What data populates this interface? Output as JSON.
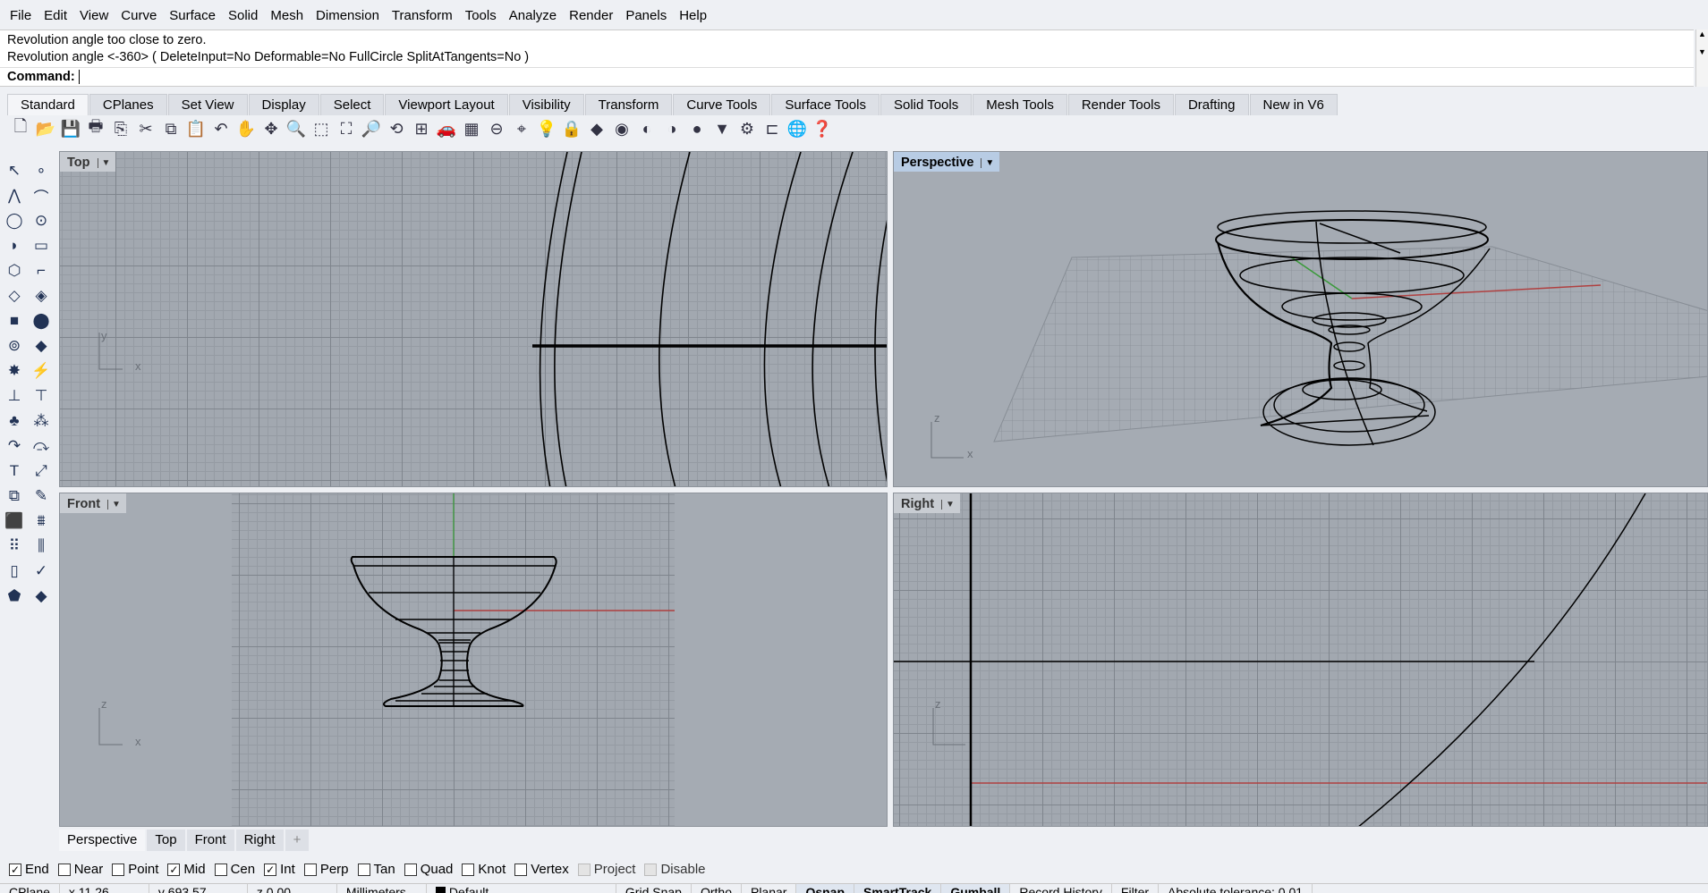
{
  "menu": [
    "File",
    "Edit",
    "View",
    "Curve",
    "Surface",
    "Solid",
    "Mesh",
    "Dimension",
    "Transform",
    "Tools",
    "Analyze",
    "Render",
    "Panels",
    "Help"
  ],
  "command": {
    "history": [
      "Revolution angle too close to zero.",
      "Revolution angle <-360> ( DeleteInput=No  Deformable=No  FullCircle  SplitAtTangents=No )"
    ],
    "prompt": "Command:",
    "value": ""
  },
  "toolbar_tabs": [
    "Standard",
    "CPlanes",
    "Set View",
    "Display",
    "Select",
    "Viewport Layout",
    "Visibility",
    "Transform",
    "Curve Tools",
    "Surface Tools",
    "Solid Tools",
    "Mesh Tools",
    "Render Tools",
    "Drafting",
    "New in V6"
  ],
  "active_toolbar_tab": "Standard",
  "standard_icons": [
    {
      "name": "new-icon",
      "g": "🗋"
    },
    {
      "name": "open-icon",
      "g": "📂"
    },
    {
      "name": "save-icon",
      "g": "💾"
    },
    {
      "name": "print-icon",
      "g": "🖶"
    },
    {
      "name": "import-icon",
      "g": "⎘"
    },
    {
      "name": "cut-icon",
      "g": "✂"
    },
    {
      "name": "copy-icon",
      "g": "⧉"
    },
    {
      "name": "paste-icon",
      "g": "📋"
    },
    {
      "name": "undo-icon",
      "g": "↶"
    },
    {
      "name": "pan-icon",
      "g": "✋"
    },
    {
      "name": "rotate-view-icon",
      "g": "✥"
    },
    {
      "name": "zoom-icon",
      "g": "🔍"
    },
    {
      "name": "zoom-window-icon",
      "g": "⬚"
    },
    {
      "name": "zoom-extents-icon",
      "g": "⛶"
    },
    {
      "name": "zoom-selected-icon",
      "g": "🔎"
    },
    {
      "name": "undo-view-icon",
      "g": "⟲"
    },
    {
      "name": "four-viewports-icon",
      "g": "⊞"
    },
    {
      "name": "car-icon",
      "g": "🚗"
    },
    {
      "name": "grid-icon",
      "g": "▦"
    },
    {
      "name": "cplane-icon",
      "g": "⊖"
    },
    {
      "name": "osnap-icon",
      "g": "⌖"
    },
    {
      "name": "light-icon",
      "g": "💡"
    },
    {
      "name": "lock-icon",
      "g": "🔒"
    },
    {
      "name": "layer-icon",
      "g": "◆"
    },
    {
      "name": "color-wheel-icon",
      "g": "◉"
    },
    {
      "name": "sphere-wire-icon",
      "g": "◐"
    },
    {
      "name": "sphere-shaded-icon",
      "g": "◑"
    },
    {
      "name": "sphere-render-icon",
      "g": "●"
    },
    {
      "name": "light-cone-icon",
      "g": "▼"
    },
    {
      "name": "options-gear-icon",
      "g": "⚙"
    },
    {
      "name": "dimension-icon",
      "g": "⊏"
    },
    {
      "name": "globe-icon",
      "g": "🌐"
    },
    {
      "name": "help-icon",
      "g": "❓"
    }
  ],
  "left_tools": [
    {
      "name": "select-icon",
      "g": "↖"
    },
    {
      "name": "point-icon",
      "g": "∘"
    },
    {
      "name": "polyline-icon",
      "g": "⋀"
    },
    {
      "name": "curve-icon",
      "g": "⌒"
    },
    {
      "name": "circle-icon",
      "g": "◯"
    },
    {
      "name": "ellipse-icon",
      "g": "⊙"
    },
    {
      "name": "arc-icon",
      "g": "◗"
    },
    {
      "name": "rectangle-icon",
      "g": "▭"
    },
    {
      "name": "polygon-icon",
      "g": "⬡"
    },
    {
      "name": "fillet-icon",
      "g": "⌐"
    },
    {
      "name": "surface-corners-icon",
      "g": "◇"
    },
    {
      "name": "surface-edge-icon",
      "g": "◈"
    },
    {
      "name": "box-icon",
      "g": "■"
    },
    {
      "name": "sphere-union-icon",
      "g": "⬤"
    },
    {
      "name": "extrude-icon",
      "g": "⊚"
    },
    {
      "name": "mesh-icon",
      "g": "◆"
    },
    {
      "name": "explode-icon",
      "g": "✸"
    },
    {
      "name": "boolean-icon",
      "g": "⚡"
    },
    {
      "name": "trim-icon",
      "g": "⊥"
    },
    {
      "name": "split-icon",
      "g": "⊤"
    },
    {
      "name": "group-icon",
      "g": "♣"
    },
    {
      "name": "ungroup-icon",
      "g": "⁂"
    },
    {
      "name": "offset-icon",
      "g": "↷"
    },
    {
      "name": "blend-icon",
      "g": "⤼"
    },
    {
      "name": "text-icon",
      "g": "T"
    },
    {
      "name": "scale-icon",
      "g": "⤢"
    },
    {
      "name": "array-icon",
      "g": "⧉"
    },
    {
      "name": "edit-icon",
      "g": "✎"
    },
    {
      "name": "solid-tools-icon",
      "g": "⬛"
    },
    {
      "name": "project-icon",
      "g": "⩩"
    },
    {
      "name": "array-grid-icon",
      "g": "⠿"
    },
    {
      "name": "distance-icon",
      "g": "⫼"
    },
    {
      "name": "analyze-icon",
      "g": "▯"
    },
    {
      "name": "check-icon",
      "g": "✓"
    },
    {
      "name": "render-objects-icon",
      "g": "⬟"
    },
    {
      "name": "material-icon",
      "g": "◆"
    }
  ],
  "viewports": {
    "top": "Top",
    "perspective": "Perspective",
    "front": "Front",
    "right": "Right"
  },
  "axis_labels": {
    "x": "x",
    "y": "y",
    "z": "z"
  },
  "viewport_tabs": [
    "Perspective",
    "Top",
    "Front",
    "Right"
  ],
  "add_tab": "+",
  "osnaps": [
    {
      "label": "End",
      "checked": true
    },
    {
      "label": "Near",
      "checked": false
    },
    {
      "label": "Point",
      "checked": false
    },
    {
      "label": "Mid",
      "checked": true
    },
    {
      "label": "Cen",
      "checked": false
    },
    {
      "label": "Int",
      "checked": true
    },
    {
      "label": "Perp",
      "checked": false
    },
    {
      "label": "Tan",
      "checked": false
    },
    {
      "label": "Quad",
      "checked": false
    },
    {
      "label": "Knot",
      "checked": false
    },
    {
      "label": "Vertex",
      "checked": false
    },
    {
      "label": "Project",
      "checked": false,
      "disabled": true
    },
    {
      "label": "Disable",
      "checked": false,
      "disabled": true
    }
  ],
  "status": {
    "cplane": "CPlane",
    "x": "x 11.26",
    "y": "y 693.57",
    "z": "z 0.00",
    "units": "Millimeters",
    "layer": "Default",
    "grid_snap": "Grid Snap",
    "ortho": "Ortho",
    "planar": "Planar",
    "osnap": "Osnap",
    "smarttrack": "SmartTrack",
    "gumball": "Gumball",
    "record_history": "Record History",
    "filter": "Filter",
    "tolerance": "Absolute tolerance: 0.01"
  },
  "colors": {
    "viewport_bg": "#a5abb3",
    "x_axis": "#b04040",
    "y_axis": "#3a9a3a",
    "active_label": "#b8cce4"
  }
}
